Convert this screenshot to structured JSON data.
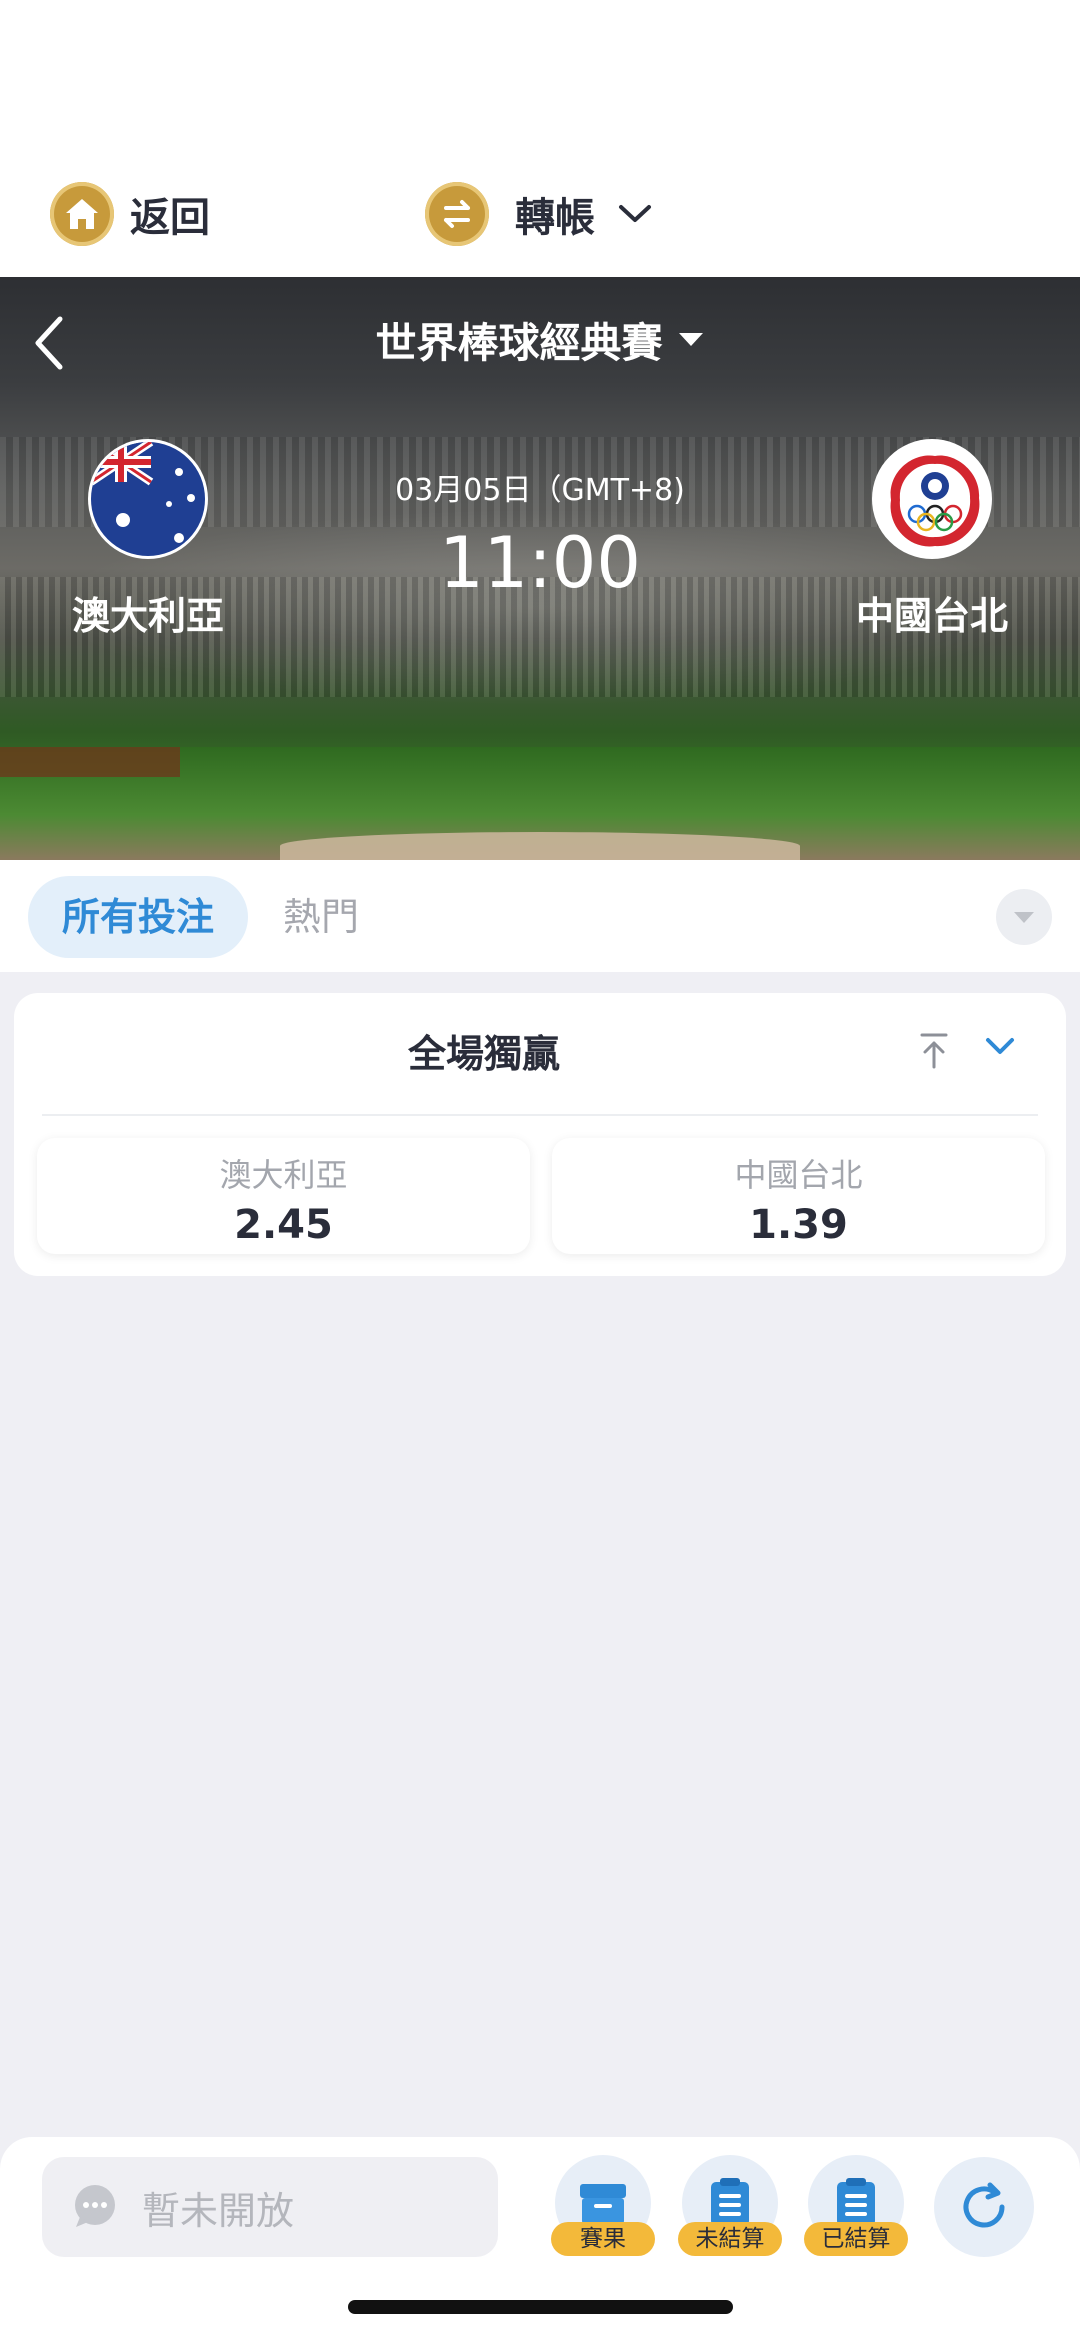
{
  "nav": {
    "back_label": "返回",
    "transfer_label": "轉帳"
  },
  "match": {
    "league": "世界棒球經典賽",
    "date": "03月05日（GMT+8)",
    "time": "11:00",
    "home_team": "澳大利亞",
    "away_team": "中國台北"
  },
  "tabs": {
    "all_bets": "所有投注",
    "popular": "熱門"
  },
  "market": {
    "title": "全場獨贏",
    "odds": [
      {
        "team": "澳大利亞",
        "price": "2.45"
      },
      {
        "team": "中國台北",
        "price": "1.39"
      }
    ]
  },
  "bottom": {
    "chat_placeholder": "暫未開放",
    "results_label": "賽果",
    "unsettled_label": "未結算",
    "settled_label": "已結算"
  },
  "colors": {
    "accent": "#2f8ad6",
    "gold": "#c79a3b",
    "badge": "#f3b93a"
  }
}
